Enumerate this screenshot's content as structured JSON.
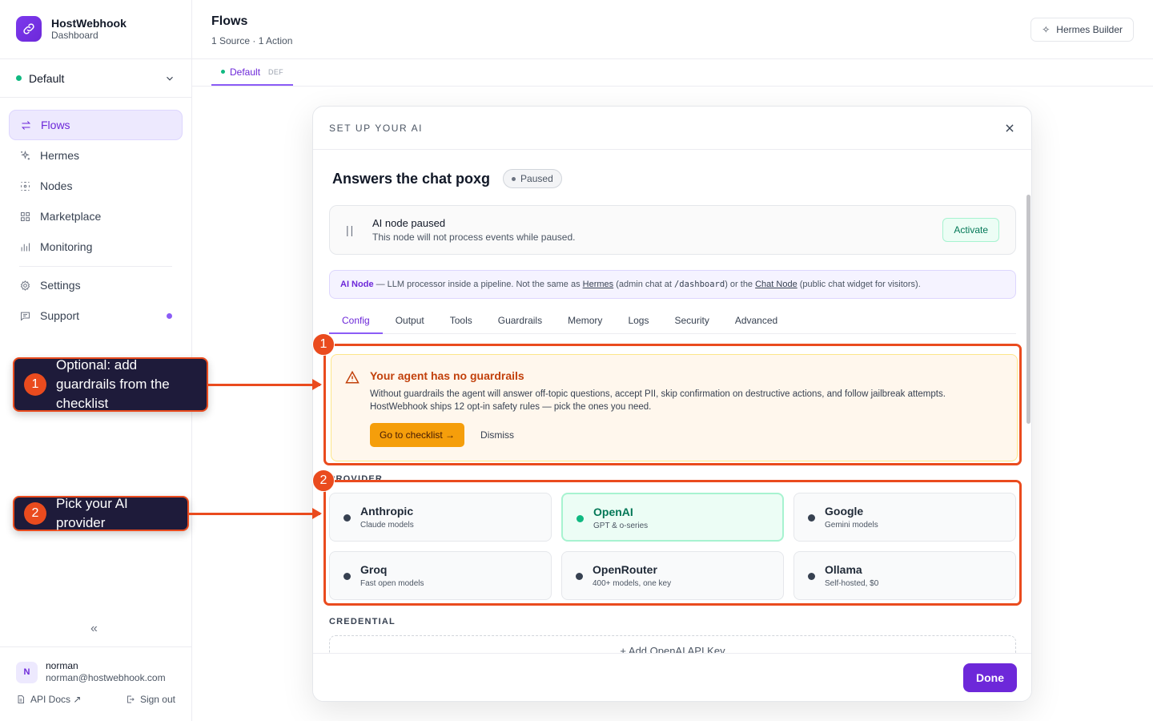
{
  "brand": {
    "title": "HostWebhook",
    "subtitle": "Dashboard"
  },
  "workspace": {
    "name": "Default",
    "status_color": "#10b981"
  },
  "nav": {
    "items": [
      {
        "label": "Flows",
        "icon": "arrows-swap-icon",
        "active": true
      },
      {
        "label": "Hermes",
        "icon": "sparkles-icon"
      },
      {
        "label": "Nodes",
        "icon": "nodes-icon"
      },
      {
        "label": "Marketplace",
        "icon": "grid-icon"
      },
      {
        "label": "Monitoring",
        "icon": "bar-chart-icon"
      },
      {
        "label": "Settings",
        "icon": "gear-icon"
      },
      {
        "label": "Support",
        "icon": "chat-icon"
      }
    ]
  },
  "user": {
    "initial": "N",
    "name": "norman",
    "email": "norman@hostwebhook.com",
    "api_docs": "API Docs ↗",
    "sign_out": "Sign out"
  },
  "header": {
    "title": "Flows",
    "subtitle": "1 Source · 1 Action",
    "builder_button": "Hermes Builder"
  },
  "flow_tab": {
    "label": "Default",
    "badge": "DEF"
  },
  "modal": {
    "title": "SET UP YOUR AI",
    "node_name": "Answers the chat poxg",
    "status_badge": "Paused",
    "paused_card": {
      "title": "AI node paused",
      "subtitle": "This node will not process events while paused.",
      "action": "Activate"
    },
    "info": {
      "lead": "AI Node",
      "t1": " — LLM processor inside a pipeline. Not the same as ",
      "link1": "Hermes",
      "t2": " (admin chat at ",
      "code": "/dashboard",
      "t3": ") or the ",
      "link2": "Chat Node",
      "t4": " (public chat widget for visitors)."
    },
    "tabs": [
      "Config",
      "Output",
      "Tools",
      "Guardrails",
      "Memory",
      "Logs",
      "Security",
      "Advanced"
    ],
    "active_tab": "Config",
    "warning": {
      "title": "Your agent has no guardrails",
      "line1": "Without guardrails the agent will answer off-topic questions, accept PII, skip confirmation on destructive actions, and follow jailbreak attempts.",
      "line2": "HostWebhook ships 12 opt-in safety rules — pick the ones you need.",
      "primary": "Go to checklist →",
      "secondary": "Dismiss"
    },
    "provider_label": "PROVIDER",
    "providers": [
      {
        "name": "Anthropic",
        "sub": "Claude models"
      },
      {
        "name": "OpenAI",
        "sub": "GPT & o-series",
        "selected": true
      },
      {
        "name": "Google",
        "sub": "Gemini models"
      },
      {
        "name": "Groq",
        "sub": "Fast open models"
      },
      {
        "name": "OpenRouter",
        "sub": "400+ models, one key"
      },
      {
        "name": "Ollama",
        "sub": "Self-hosted, $0"
      }
    ],
    "credential_label": "CREDENTIAL",
    "add_key": "+ Add OpenAI API Key",
    "done": "Done"
  },
  "annotations": [
    {
      "number": "1",
      "text": "Optional: add guardrails from the checklist"
    },
    {
      "number": "2",
      "text": "Pick your AI provider"
    }
  ],
  "colors": {
    "accent": "#6d28d9",
    "annotation": "#ea4b1e",
    "warning": "#f59e0b",
    "success": "#10b981"
  }
}
